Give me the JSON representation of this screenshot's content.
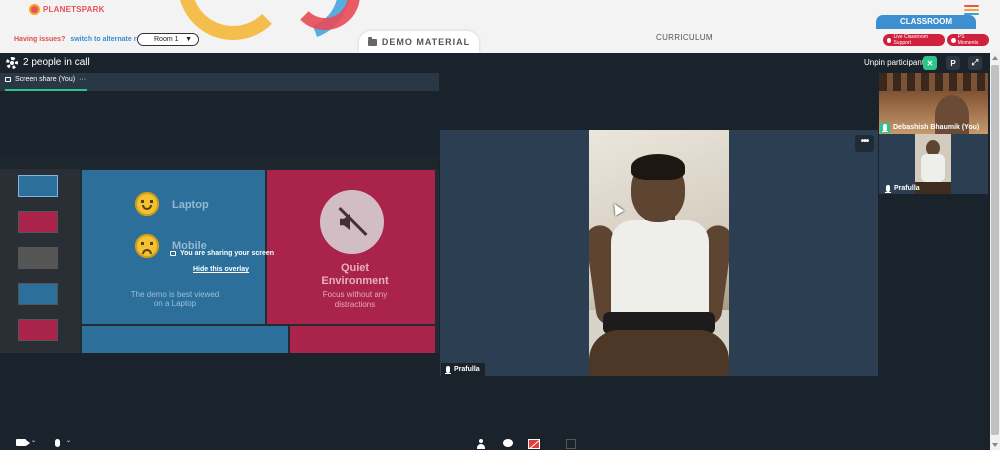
{
  "app": {
    "logo_text": "PLANETSPARK",
    "hamburger_colors": [
      "#e8505b",
      "#f5a623",
      "#3aa1e0"
    ]
  },
  "topbar": {
    "issues_text": "Having issues?",
    "alternate_room_link": "switch to alternate room",
    "room_select_value": "Room 1",
    "demo_material_label": "DEMO MATERIAL",
    "curriculum_label": "CURRICULUM",
    "classroom_tab": "CLASSROOM",
    "classroom_support_label": "Live Classroom Support",
    "moments_label": "PS Moments"
  },
  "call": {
    "people_count_label": "2 people in call",
    "unpin_label": "Unpin participant",
    "close_glyph": "✕",
    "pin_glyph": "P",
    "fullscreen_glyph": "⤢"
  },
  "screen_share": {
    "tab_label": "Screen share (You)",
    "tab_more": "···",
    "sharing_notice": "You are sharing your screen",
    "hide_overlay_link": "Hide this overlay",
    "slide": {
      "word1": "Laptop",
      "word2": "Mobile",
      "demo_note_line1": "The demo is best viewed",
      "demo_note_line2": "on a Laptop",
      "quiet_title_line1": "Quiet",
      "quiet_title_line2": "Environment",
      "quiet_sub_line1": "Focus without any",
      "quiet_sub_line2": "distractions"
    }
  },
  "main_participant": {
    "name": "Prafulla",
    "more_glyph": "•••"
  },
  "sidebar": {
    "self_name": "Debashish Bhaumik (You)",
    "other_name": "Prafulla"
  },
  "colors": {
    "accent_green": "#2bc48a",
    "brand_red": "#d0203d",
    "brand_blue": "#3d8fd0",
    "call_bg": "#1a232c"
  }
}
